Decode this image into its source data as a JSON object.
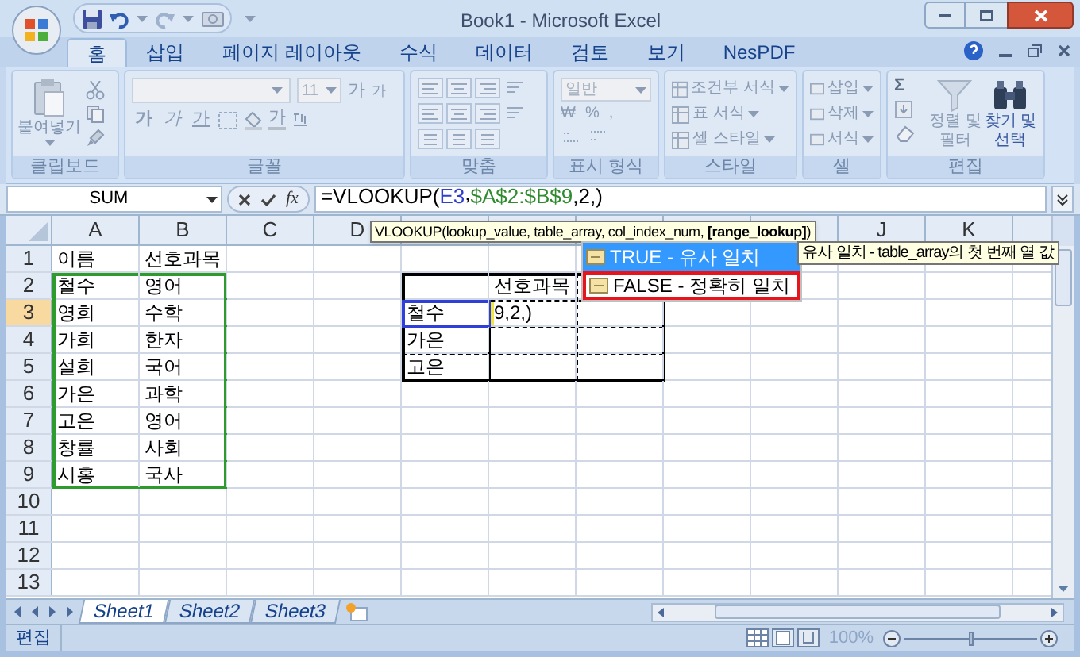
{
  "window": {
    "title": "Book1 - Microsoft Excel"
  },
  "ribbon": {
    "tabs": [
      {
        "label": "홈",
        "selected": true
      },
      {
        "label": "삽입",
        "selected": false
      },
      {
        "label": "페이지 레이아웃",
        "selected": false
      },
      {
        "label": "수식",
        "selected": false
      },
      {
        "label": "데이터",
        "selected": false
      },
      {
        "label": "검토",
        "selected": false
      },
      {
        "label": "보기",
        "selected": false
      },
      {
        "label": "NesPDF",
        "selected": false
      }
    ],
    "clipboard": {
      "title": "클립보드",
      "paste": "붙여넣기"
    },
    "font": {
      "title": "글꼴",
      "size": "11",
      "grow": "가",
      "shrink": "가",
      "buttons": [
        "가",
        "가",
        "가"
      ],
      "font_color_button": "가"
    },
    "alignment": {
      "title": "맞춤"
    },
    "number": {
      "title": "표시 형식",
      "format": "일반",
      "buttons": [
        "₩",
        "%",
        ","
      ]
    },
    "styles": {
      "title": "스타일",
      "items": [
        "조건부 서식",
        "표 서식",
        "셀 스타일"
      ]
    },
    "cells": {
      "title": "셀",
      "items": [
        "삽입",
        "삭제",
        "서식"
      ]
    },
    "editing": {
      "title": "편집",
      "sum": "Σ",
      "sort": "정렬 및\n필터",
      "find": "찾기 및\n선택"
    }
  },
  "formula_bar": {
    "name_box": "SUM",
    "function_button": "fx",
    "formula": [
      {
        "text": "=VLOOKUP(",
        "color": "#000000"
      },
      {
        "text": "E3",
        "color": "#2f3fc8"
      },
      {
        "text": ",",
        "color": "#000000"
      },
      {
        "text": "$A$2:$B$9",
        "color": "#2e8b2e"
      },
      {
        "text": ",2,)",
        "color": "#000000"
      }
    ]
  },
  "function_tooltip": "VLOOKUP(lookup_value, table_array, col_index_num, **[range_lookup]**)",
  "autocomplete": {
    "items": [
      {
        "label": "TRUE - 유사 일치",
        "selected": true,
        "outlined": false
      },
      {
        "label": "FALSE - 정확히 일치",
        "selected": false,
        "outlined": true
      }
    ],
    "hint": "유사 일치 - table_array의 첫 번째 열 값"
  },
  "sheet": {
    "column_headers_left": [
      "A",
      "B",
      "C",
      "D"
    ],
    "column_headers_right": [
      "J",
      "K"
    ],
    "rows": [
      {
        "header": "1",
        "selected": false,
        "cells": [
          "이름",
          "선호과목"
        ]
      },
      {
        "header": "2",
        "selected": false,
        "cells": [
          "철수",
          "영어",
          null,
          null,
          null,
          "선호과목"
        ]
      },
      {
        "header": "3",
        "selected": true,
        "cells": [
          "영희",
          "수학",
          null,
          null,
          "철수",
          "9,2,)"
        ]
      },
      {
        "header": "4",
        "selected": false,
        "cells": [
          "가희",
          "한자",
          null,
          null,
          "가은"
        ]
      },
      {
        "header": "5",
        "selected": false,
        "cells": [
          "설희",
          "국어",
          null,
          null,
          "고은"
        ]
      },
      {
        "header": "6",
        "selected": false,
        "cells": [
          "가은",
          "과학"
        ]
      },
      {
        "header": "7",
        "selected": false,
        "cells": [
          "고은",
          "영어"
        ]
      },
      {
        "header": "8",
        "selected": false,
        "cells": [
          "창률",
          "사회"
        ]
      },
      {
        "header": "9",
        "selected": false,
        "cells": [
          "시홍",
          "국사"
        ]
      },
      {
        "header": "10",
        "selected": false,
        "cells": []
      },
      {
        "header": "11",
        "selected": false,
        "cells": []
      },
      {
        "header": "12",
        "selected": false,
        "cells": []
      },
      {
        "header": "13",
        "selected": false,
        "cells": []
      }
    ]
  },
  "sheet_tabs": [
    {
      "label": "Sheet1",
      "selected": true
    },
    {
      "label": "Sheet2",
      "selected": false
    },
    {
      "label": "Sheet3",
      "selected": false
    }
  ],
  "status_bar": {
    "mode": "편집",
    "zoom": "100%",
    "zoom_slider": {
      "level": 0.5
    }
  }
}
